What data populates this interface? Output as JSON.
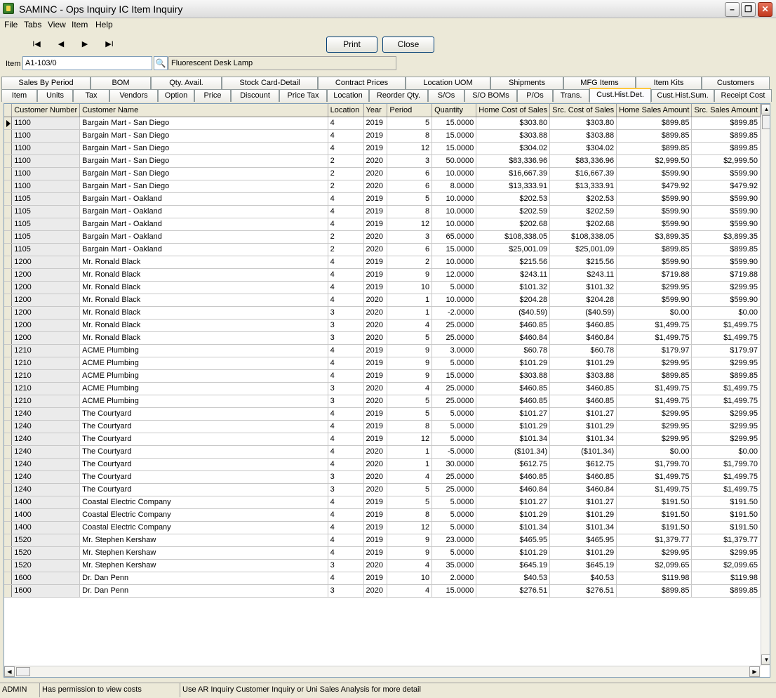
{
  "window": {
    "title": "SAMINC - Ops Inquiry IC Item Inquiry"
  },
  "menu": [
    "File",
    "Tabs",
    "View",
    "Item",
    "Help"
  ],
  "nav": {
    "first": "I◀",
    "prev": "◀",
    "next": "▶",
    "last": "▶I"
  },
  "buttons": {
    "print": "Print",
    "close": "Close"
  },
  "item": {
    "label": "Item",
    "value": "A1-103/0",
    "description": "Fluorescent Desk Lamp"
  },
  "tabs_row1": [
    "Sales By Period",
    "BOM",
    "Qty. Avail.",
    "Stock Card-Detail",
    "Contract Prices",
    "Location UOM",
    "Shipments",
    "MFG Items",
    "Item Kits",
    "Customers"
  ],
  "tabs_row2": [
    "Item",
    "Units",
    "Tax",
    "Vendors",
    "Option",
    "Price",
    "Discount",
    "Price Tax",
    "Location",
    "Reorder Qty.",
    "S/Os",
    "S/O BOMs",
    "P/Os",
    "Trans.",
    "Cust.Hist.Det.",
    "Cust.Hist.Sum.",
    "Receipt Cost"
  ],
  "active_tab": "Cust.Hist.Det.",
  "grid": {
    "columns": [
      "Customer Number",
      "Customer Name",
      "Location",
      "Year",
      "Period",
      "Quantity",
      "Home Cost of Sales",
      "Src. Cost of Sales",
      "Home Sales Amount",
      "Src. Sales Amount"
    ],
    "rows": [
      [
        "1100",
        "Bargain Mart - San Diego",
        "4",
        "2019",
        "5",
        "15.0000",
        "$303.80",
        "$303.80",
        "$899.85",
        "$899.85"
      ],
      [
        "1100",
        "Bargain Mart - San Diego",
        "4",
        "2019",
        "8",
        "15.0000",
        "$303.88",
        "$303.88",
        "$899.85",
        "$899.85"
      ],
      [
        "1100",
        "Bargain Mart - San Diego",
        "4",
        "2019",
        "12",
        "15.0000",
        "$304.02",
        "$304.02",
        "$899.85",
        "$899.85"
      ],
      [
        "1100",
        "Bargain Mart - San Diego",
        "2",
        "2020",
        "3",
        "50.0000",
        "$83,336.96",
        "$83,336.96",
        "$2,999.50",
        "$2,999.50"
      ],
      [
        "1100",
        "Bargain Mart - San Diego",
        "2",
        "2020",
        "6",
        "10.0000",
        "$16,667.39",
        "$16,667.39",
        "$599.90",
        "$599.90"
      ],
      [
        "1100",
        "Bargain Mart - San Diego",
        "2",
        "2020",
        "6",
        "8.0000",
        "$13,333.91",
        "$13,333.91",
        "$479.92",
        "$479.92"
      ],
      [
        "1105",
        "Bargain Mart - Oakland",
        "4",
        "2019",
        "5",
        "10.0000",
        "$202.53",
        "$202.53",
        "$599.90",
        "$599.90"
      ],
      [
        "1105",
        "Bargain Mart - Oakland",
        "4",
        "2019",
        "8",
        "10.0000",
        "$202.59",
        "$202.59",
        "$599.90",
        "$599.90"
      ],
      [
        "1105",
        "Bargain Mart - Oakland",
        "4",
        "2019",
        "12",
        "10.0000",
        "$202.68",
        "$202.68",
        "$599.90",
        "$599.90"
      ],
      [
        "1105",
        "Bargain Mart - Oakland",
        "2",
        "2020",
        "3",
        "65.0000",
        "$108,338.05",
        "$108,338.05",
        "$3,899.35",
        "$3,899.35"
      ],
      [
        "1105",
        "Bargain Mart - Oakland",
        "2",
        "2020",
        "6",
        "15.0000",
        "$25,001.09",
        "$25,001.09",
        "$899.85",
        "$899.85"
      ],
      [
        "1200",
        "Mr. Ronald Black",
        "4",
        "2019",
        "2",
        "10.0000",
        "$215.56",
        "$215.56",
        "$599.90",
        "$599.90"
      ],
      [
        "1200",
        "Mr. Ronald Black",
        "4",
        "2019",
        "9",
        "12.0000",
        "$243.11",
        "$243.11",
        "$719.88",
        "$719.88"
      ],
      [
        "1200",
        "Mr. Ronald Black",
        "4",
        "2019",
        "10",
        "5.0000",
        "$101.32",
        "$101.32",
        "$299.95",
        "$299.95"
      ],
      [
        "1200",
        "Mr. Ronald Black",
        "4",
        "2020",
        "1",
        "10.0000",
        "$204.28",
        "$204.28",
        "$599.90",
        "$599.90"
      ],
      [
        "1200",
        "Mr. Ronald Black",
        "3",
        "2020",
        "1",
        "-2.0000",
        "($40.59)",
        "($40.59)",
        "$0.00",
        "$0.00"
      ],
      [
        "1200",
        "Mr. Ronald Black",
        "3",
        "2020",
        "4",
        "25.0000",
        "$460.85",
        "$460.85",
        "$1,499.75",
        "$1,499.75"
      ],
      [
        "1200",
        "Mr. Ronald Black",
        "3",
        "2020",
        "5",
        "25.0000",
        "$460.84",
        "$460.84",
        "$1,499.75",
        "$1,499.75"
      ],
      [
        "1210",
        "ACME Plumbing",
        "4",
        "2019",
        "9",
        "3.0000",
        "$60.78",
        "$60.78",
        "$179.97",
        "$179.97"
      ],
      [
        "1210",
        "ACME Plumbing",
        "4",
        "2019",
        "9",
        "5.0000",
        "$101.29",
        "$101.29",
        "$299.95",
        "$299.95"
      ],
      [
        "1210",
        "ACME Plumbing",
        "4",
        "2019",
        "9",
        "15.0000",
        "$303.88",
        "$303.88",
        "$899.85",
        "$899.85"
      ],
      [
        "1210",
        "ACME Plumbing",
        "3",
        "2020",
        "4",
        "25.0000",
        "$460.85",
        "$460.85",
        "$1,499.75",
        "$1,499.75"
      ],
      [
        "1210",
        "ACME Plumbing",
        "3",
        "2020",
        "5",
        "25.0000",
        "$460.85",
        "$460.85",
        "$1,499.75",
        "$1,499.75"
      ],
      [
        "1240",
        "The Courtyard",
        "4",
        "2019",
        "5",
        "5.0000",
        "$101.27",
        "$101.27",
        "$299.95",
        "$299.95"
      ],
      [
        "1240",
        "The Courtyard",
        "4",
        "2019",
        "8",
        "5.0000",
        "$101.29",
        "$101.29",
        "$299.95",
        "$299.95"
      ],
      [
        "1240",
        "The Courtyard",
        "4",
        "2019",
        "12",
        "5.0000",
        "$101.34",
        "$101.34",
        "$299.95",
        "$299.95"
      ],
      [
        "1240",
        "The Courtyard",
        "4",
        "2020",
        "1",
        "-5.0000",
        "($101.34)",
        "($101.34)",
        "$0.00",
        "$0.00"
      ],
      [
        "1240",
        "The Courtyard",
        "4",
        "2020",
        "1",
        "30.0000",
        "$612.75",
        "$612.75",
        "$1,799.70",
        "$1,799.70"
      ],
      [
        "1240",
        "The Courtyard",
        "3",
        "2020",
        "4",
        "25.0000",
        "$460.85",
        "$460.85",
        "$1,499.75",
        "$1,499.75"
      ],
      [
        "1240",
        "The Courtyard",
        "3",
        "2020",
        "5",
        "25.0000",
        "$460.84",
        "$460.84",
        "$1,499.75",
        "$1,499.75"
      ],
      [
        "1400",
        "Coastal Electric Company",
        "4",
        "2019",
        "5",
        "5.0000",
        "$101.27",
        "$101.27",
        "$191.50",
        "$191.50"
      ],
      [
        "1400",
        "Coastal Electric Company",
        "4",
        "2019",
        "8",
        "5.0000",
        "$101.29",
        "$101.29",
        "$191.50",
        "$191.50"
      ],
      [
        "1400",
        "Coastal Electric Company",
        "4",
        "2019",
        "12",
        "5.0000",
        "$101.34",
        "$101.34",
        "$191.50",
        "$191.50"
      ],
      [
        "1520",
        "Mr. Stephen Kershaw",
        "4",
        "2019",
        "9",
        "23.0000",
        "$465.95",
        "$465.95",
        "$1,379.77",
        "$1,379.77"
      ],
      [
        "1520",
        "Mr. Stephen Kershaw",
        "4",
        "2019",
        "9",
        "5.0000",
        "$101.29",
        "$101.29",
        "$299.95",
        "$299.95"
      ],
      [
        "1520",
        "Mr. Stephen Kershaw",
        "3",
        "2020",
        "4",
        "35.0000",
        "$645.19",
        "$645.19",
        "$2,099.65",
        "$2,099.65"
      ],
      [
        "1600",
        "Dr. Dan Penn",
        "4",
        "2019",
        "10",
        "2.0000",
        "$40.53",
        "$40.53",
        "$119.98",
        "$119.98"
      ],
      [
        "1600",
        "Dr. Dan Penn",
        "3",
        "2020",
        "4",
        "15.0000",
        "$276.51",
        "$276.51",
        "$899.85",
        "$899.85"
      ]
    ]
  },
  "status": {
    "user": "ADMIN",
    "permission": "Has permission to view costs",
    "hint": "Use AR Inquiry Customer Inquiry or Uni Sales Analysis for more detail"
  },
  "colors": {
    "window_bg": "#ece9d8",
    "active_tab_accent": "#ffc83c",
    "grid_line": "#c8c8c8"
  }
}
